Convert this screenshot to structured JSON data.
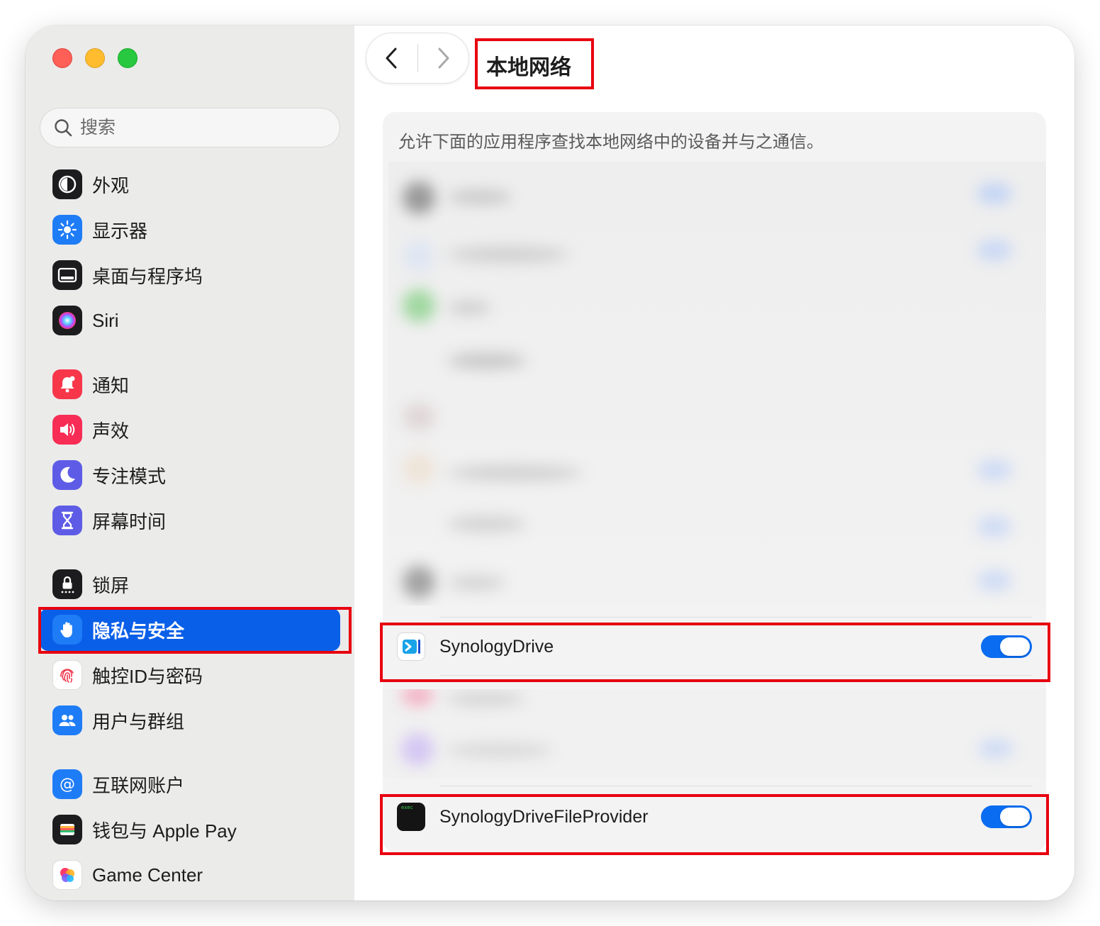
{
  "window": {
    "traffic_lights": [
      "close",
      "minimize",
      "zoom"
    ]
  },
  "sidebar": {
    "search_placeholder": "搜索",
    "items": [
      {
        "label": "外观",
        "icon": "appearance-icon"
      },
      {
        "label": "显示器",
        "icon": "display-icon"
      },
      {
        "label": "桌面与程序坞",
        "icon": "desktop-dock-icon"
      },
      {
        "label": "Siri",
        "icon": "siri-icon"
      },
      {
        "label": "通知",
        "icon": "notification-icon"
      },
      {
        "label": "声效",
        "icon": "sound-icon"
      },
      {
        "label": "专注模式",
        "icon": "focus-icon"
      },
      {
        "label": "屏幕时间",
        "icon": "screen-time-icon"
      },
      {
        "label": "锁屏",
        "icon": "lock-screen-icon"
      },
      {
        "label": "隐私与安全",
        "icon": "privacy-hand-icon",
        "selected": true
      },
      {
        "label": "触控ID与密码",
        "icon": "touch-id-icon"
      },
      {
        "label": "用户与群组",
        "icon": "users-icon"
      },
      {
        "label": "互联网账户",
        "icon": "internet-accounts-icon"
      },
      {
        "label": "钱包与 Apple Pay",
        "icon": "wallet-icon"
      },
      {
        "label": "Game Center",
        "icon": "game-center-icon"
      }
    ]
  },
  "header": {
    "title": "本地网络"
  },
  "content": {
    "description": "允许下面的应用程序查找本地网络中的设备并与之通信。",
    "apps": [
      {
        "name": "SynologyDrive",
        "enabled": true,
        "icon": "synology-drive-icon"
      },
      {
        "name": "SynologyDriveFileProvider",
        "enabled": true,
        "icon": "exec-terminal-icon",
        "icon_text": "exec"
      }
    ]
  },
  "colors": {
    "accent": "#0a5fe8",
    "highlight": "#e8000f",
    "toggle_on": "#0a6cf0"
  }
}
